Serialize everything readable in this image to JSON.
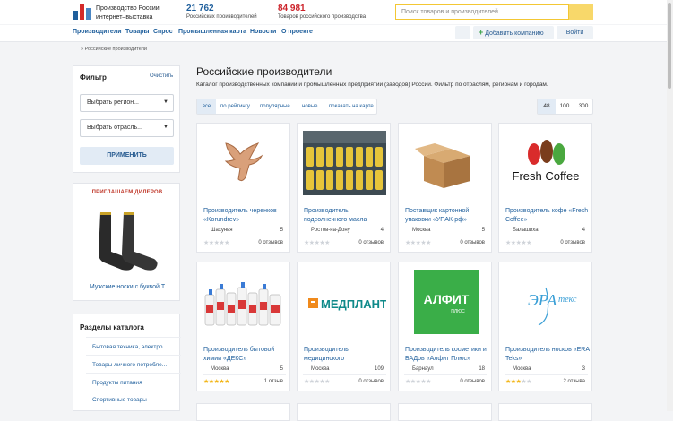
{
  "header": {
    "brand_line1": "Производство России",
    "brand_line2": "интернет–выставка",
    "stat1_value": "21 762",
    "stat1_label": "Российских производителей",
    "stat2_value": "84 981",
    "stat2_label": "Товаров российского производства",
    "search_placeholder": "Поиск товаров и производителей..."
  },
  "nav": {
    "items": [
      "Производители",
      "Товары",
      "Спрос",
      "Промышленная карта",
      "Новости",
      "О проекте"
    ],
    "add_company": "Добавить компанию",
    "login": "Войти"
  },
  "breadcrumb": "» Российские производители",
  "filter": {
    "title": "Фильтр",
    "clear": "Очистить",
    "region": "Выбрать регион...",
    "industry": "Выбрать отрасль...",
    "apply": "ПРИМЕНИТЬ"
  },
  "dealers": {
    "title": "ПРИГЛАШАЕМ ДИЛЕРОВ",
    "caption": "Мужские носки с буквой Т"
  },
  "sections": {
    "title": "Разделы каталога",
    "items": [
      "Бытовая техника, электро...",
      "Товары личного потребле...",
      "Продукты питания",
      "Спортивные товары"
    ]
  },
  "main": {
    "title": "Российские производители",
    "description": "Каталог производственных компаний и промышленных предприятий (заводов) России. Фильтр по отраслям, регионам и городам.",
    "tabs": [
      "все",
      "по рейтингу",
      "популярные",
      "новые",
      "показать на карте"
    ],
    "per_page": [
      "48",
      "100",
      "300"
    ]
  },
  "cards": [
    {
      "title": "Производитель черенков «Korundrev»",
      "city": "Шахунья",
      "count": "5",
      "reviews": "0 отзывов",
      "rating": 0,
      "image": "eagle-logo"
    },
    {
      "title": "Производитель подсолнечного масла",
      "city": "Ростов-на-Дону",
      "count": "4",
      "reviews": "0 отзывов",
      "rating": 0,
      "image": "oil-factory-photo"
    },
    {
      "title": "Поставщик картонной упаковки «УПАК-рф»",
      "city": "Москва",
      "count": "5",
      "reviews": "0 отзывов",
      "rating": 0,
      "image": "cardboard-box"
    },
    {
      "title": "Производитель кофе «Fresh Coffee»",
      "city": "Балашиха",
      "count": "4",
      "reviews": "0 отзывов",
      "rating": 0,
      "image": "fresh-coffee-logo",
      "logo_text": "Fresh Coffee"
    },
    {
      "title": "Производитель бытовой химии «ДЕКС»",
      "city": "Москва",
      "count": "5",
      "reviews": "1 отзыв",
      "rating": 5,
      "image": "chemicals-bottles"
    },
    {
      "title": "Производитель медицинского",
      "city": "Москва",
      "count": "109",
      "reviews": "0 отзывов",
      "rating": 0,
      "image": "medplant-logo",
      "logo_text": "МЕДПЛАНТ"
    },
    {
      "title": "Производитель косметики и БАДов «Алфит Плюс»",
      "city": "Барнаул",
      "count": "18",
      "reviews": "0 отзывов",
      "rating": 0,
      "image": "alfit-logo",
      "logo_text": "АЛФИТ",
      "logo_sub": "ПЛЮС"
    },
    {
      "title": "Производитель носков «ERA Teks»",
      "city": "Москва",
      "count": "3",
      "reviews": "2 отзыва",
      "rating": 3,
      "image": "era-teks-logo",
      "logo_text": "ЭРА",
      "logo_sub": "текс"
    }
  ],
  "colors": {
    "accent_blue": "#1f5f9c",
    "stat_red": "#cc2229",
    "search_yellow": "#f3c734",
    "add_green": "#3aa34a",
    "star_gold": "#f2b619",
    "alfit_green": "#3aae48",
    "medplant_orange": "#f08a1c",
    "medplant_teal": "#0f8a8a"
  }
}
